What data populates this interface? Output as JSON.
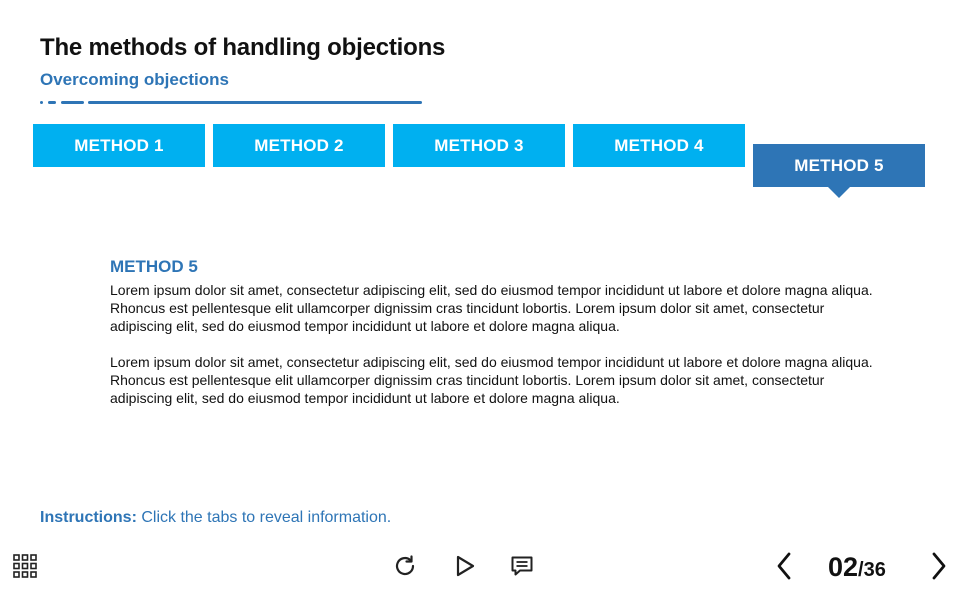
{
  "header": {
    "title": "The methods of handling objections",
    "subtitle": "Overcoming objections"
  },
  "tabs": [
    {
      "label": "METHOD 1",
      "active": false
    },
    {
      "label": "METHOD 2",
      "active": false
    },
    {
      "label": "METHOD 3",
      "active": false
    },
    {
      "label": "METHOD 4",
      "active": false
    },
    {
      "label": "METHOD 5",
      "active": true
    }
  ],
  "content": {
    "heading": "METHOD 5",
    "paragraphs": [
      "Lorem ipsum dolor sit amet, consectetur adipiscing elit, sed do eiusmod tempor incididunt ut labore et dolore magna aliqua. Rhoncus est pellentesque elit ullamcorper dignissim cras tincidunt lobortis. Lorem ipsum dolor sit amet, consectetur adipiscing elit, sed do eiusmod tempor incididunt ut labore et dolore magna aliqua.",
      "Lorem ipsum dolor sit amet, consectetur adipiscing elit, sed do eiusmod tempor incididunt ut labore et dolore magna aliqua. Rhoncus est pellentesque elit ullamcorper dignissim cras tincidunt lobortis. Lorem ipsum dolor sit amet, consectetur adipiscing elit, sed do eiusmod tempor incididunt ut labore et dolore magna aliqua."
    ]
  },
  "instructions": {
    "label": "Instructions:",
    "text": " Click the tabs to reveal information."
  },
  "footer": {
    "icons": [
      "grid-menu-icon",
      "replay-icon",
      "play-icon",
      "comment-icon",
      "chevron-left-icon",
      "chevron-right-icon"
    ],
    "page_current": "02",
    "page_separator": "/",
    "page_total": "36"
  },
  "colors": {
    "accent_blue": "#2e75b6",
    "tab_cyan": "#00b0f0",
    "text_dark": "#111111"
  }
}
